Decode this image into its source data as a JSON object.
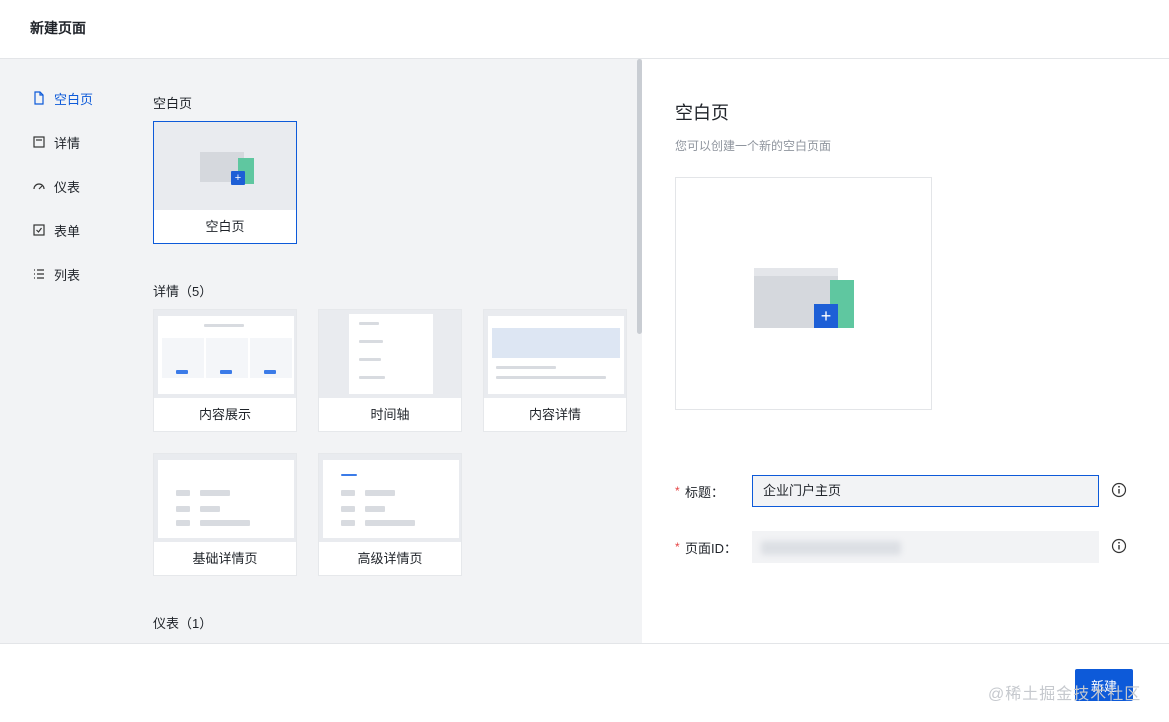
{
  "header": {
    "title": "新建页面"
  },
  "nav": {
    "items": [
      {
        "label": "空白页",
        "icon": "file-icon"
      },
      {
        "label": "详情",
        "icon": "detail-icon"
      },
      {
        "label": "仪表",
        "icon": "gauge-icon"
      },
      {
        "label": "表单",
        "icon": "checkbox-icon"
      },
      {
        "label": "列表",
        "icon": "list-icon"
      }
    ]
  },
  "sections": {
    "blank": {
      "title": "空白页",
      "cards": [
        {
          "label": "空白页"
        }
      ]
    },
    "detail": {
      "title": "详情（5）",
      "cards": [
        {
          "label": "内容展示"
        },
        {
          "label": "时间轴"
        },
        {
          "label": "内容详情"
        },
        {
          "label": "基础详情页"
        },
        {
          "label": "高级详情页"
        }
      ]
    },
    "dashboard": {
      "title": "仪表（1）"
    }
  },
  "preview_panel": {
    "title": "空白页",
    "description": "您可以创建一个新的空白页面"
  },
  "form": {
    "title_label": "标题：",
    "title_value": "企业门户主页",
    "page_id_label": "页面ID："
  },
  "footer": {
    "create_label": "新建",
    "watermark": "@稀土掘金技术社区"
  },
  "colors": {
    "accent": "#0d5ad9",
    "required": "#e54545",
    "panel_bg": "#f2f3f5"
  }
}
